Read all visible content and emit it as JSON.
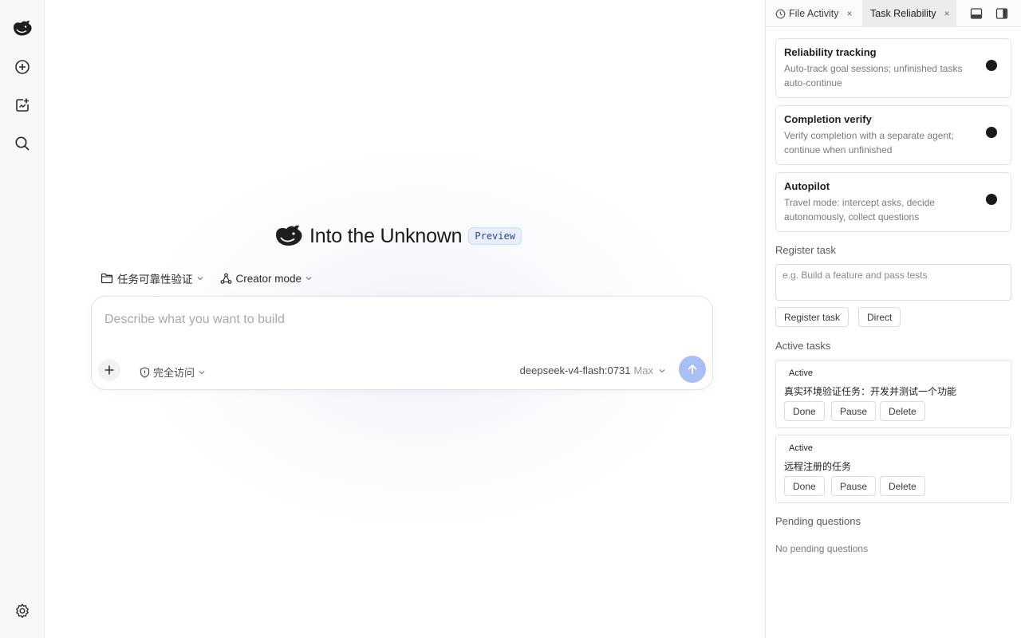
{
  "main": {
    "title": "Into the Unknown",
    "badge": "Preview",
    "project_chip": "任务可靠性验证",
    "mode_chip": "Creator mode",
    "composer": {
      "placeholder": "Describe what you want to build",
      "access_label": "完全访问",
      "model_name": "deepseek-v4-flash:0731",
      "model_tier": "Max"
    }
  },
  "rail": {
    "icons": [
      "whale-logo-icon",
      "new-chat-icon",
      "new-project-icon",
      "search-icon",
      "settings-icon"
    ]
  },
  "panel": {
    "tabs": [
      {
        "label": "File Activity",
        "close": "×"
      },
      {
        "label": "Task Reliability",
        "close": "×"
      }
    ],
    "settings": [
      {
        "title": "Reliability tracking",
        "desc": "Auto-track goal sessions; unfinished tasks auto-continue"
      },
      {
        "title": "Completion verify",
        "desc": "Verify completion with a separate agent; continue when unfinished"
      },
      {
        "title": "Autopilot",
        "desc": "Travel mode: intercept asks, decide autonomously, collect questions"
      }
    ],
    "register_label": "Register task",
    "register_placeholder": "e.g. Build a feature and pass tests",
    "register_button": "Register task",
    "direct_button": "Direct",
    "active_label": "Active tasks",
    "tasks": [
      {
        "status": "Active",
        "name": "真实环境验证任务：开发并测试一个功能",
        "done": "Done",
        "pause": "Pause",
        "delete": "Delete"
      },
      {
        "status": "Active",
        "name": "远程注册的任务",
        "done": "Done",
        "pause": "Pause",
        "delete": "Delete"
      }
    ],
    "pending_label": "Pending questions",
    "pending_empty": "No pending questions"
  },
  "colors": {
    "accent_send": "#a9bef3",
    "badge_bg": "#e8eefb",
    "badge_text": "#2c4a8a",
    "toggle": "#1a1a1c"
  }
}
